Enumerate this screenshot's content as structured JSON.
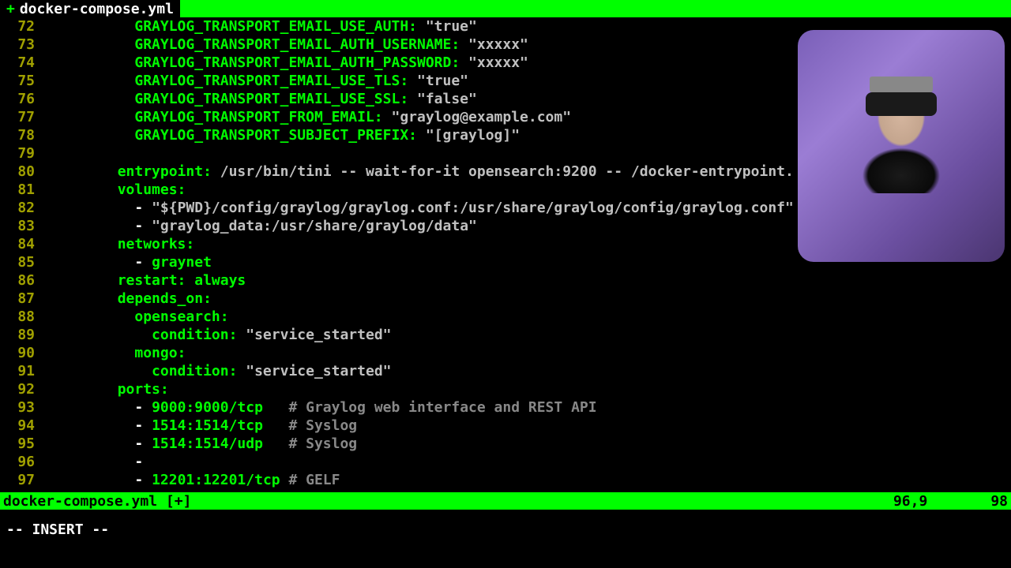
{
  "tab": {
    "marker": "+",
    "title": "docker-compose.yml"
  },
  "status": {
    "file": "docker-compose.yml [+]",
    "pos": "96,9",
    "pct": "98"
  },
  "mode": "-- INSERT --",
  "lines": [
    {
      "n": "72",
      "i": "          ",
      "k": "GRAYLOG_TRANSPORT_EMAIL_USE_AUTH:",
      "s": " \"true\""
    },
    {
      "n": "73",
      "i": "          ",
      "k": "GRAYLOG_TRANSPORT_EMAIL_AUTH_USERNAME:",
      "s": " \"xxxxx\""
    },
    {
      "n": "74",
      "i": "          ",
      "k": "GRAYLOG_TRANSPORT_EMAIL_AUTH_PASSWORD:",
      "s": " \"xxxxx\""
    },
    {
      "n": "75",
      "i": "          ",
      "k": "GRAYLOG_TRANSPORT_EMAIL_USE_TLS:",
      "s": " \"true\""
    },
    {
      "n": "76",
      "i": "          ",
      "k": "GRAYLOG_TRANSPORT_EMAIL_USE_SSL:",
      "s": " \"false\""
    },
    {
      "n": "77",
      "i": "          ",
      "k": "GRAYLOG_TRANSPORT_FROM_EMAIL:",
      "s": " \"graylog@example.com\""
    },
    {
      "n": "78",
      "i": "          ",
      "k": "GRAYLOG_TRANSPORT_SUBJECT_PREFIX:",
      "s": " \"[graylog]\""
    },
    {
      "n": "79",
      "blank": true
    },
    {
      "n": "80",
      "i": "        ",
      "k": "entrypoint:",
      "p": " /usr/bin/tini -- wait-for-it opensearch:9200 -- /docker-entrypoint."
    },
    {
      "n": "81",
      "i": "        ",
      "k": "volumes:"
    },
    {
      "n": "82",
      "i": "          ",
      "d": "- ",
      "s": "\"${PWD}/config/graylog/graylog.conf:/usr/share/graylog/config/graylog.conf\""
    },
    {
      "n": "83",
      "i": "          ",
      "d": "- ",
      "s": "\"graylog_data:/usr/share/graylog/data\""
    },
    {
      "n": "84",
      "i": "        ",
      "k": "networks:"
    },
    {
      "n": "85",
      "i": "          ",
      "d": "- ",
      "v": "graynet"
    },
    {
      "n": "86",
      "i": "        ",
      "k": "restart:",
      "v": " always"
    },
    {
      "n": "87",
      "i": "        ",
      "k": "depends_on:"
    },
    {
      "n": "88",
      "i": "          ",
      "k": "opensearch:"
    },
    {
      "n": "89",
      "i": "            ",
      "k": "condition:",
      "s": " \"service_started\""
    },
    {
      "n": "90",
      "i": "          ",
      "k": "mongo:"
    },
    {
      "n": "91",
      "i": "            ",
      "k": "condition:",
      "s": " \"service_started\""
    },
    {
      "n": "92",
      "i": "        ",
      "k": "ports:"
    },
    {
      "n": "93",
      "i": "          ",
      "d": "- ",
      "v": "9000:9000/tcp   ",
      "c": "# Graylog web interface and REST API"
    },
    {
      "n": "94",
      "i": "          ",
      "d": "- ",
      "v": "1514:1514/tcp   ",
      "c": "# Syslog"
    },
    {
      "n": "95",
      "i": "          ",
      "d": "- ",
      "v": "1514:1514/udp   ",
      "c": "# Syslog"
    },
    {
      "n": "96",
      "i": "          ",
      "d": "-"
    },
    {
      "n": "97",
      "i": "          ",
      "d": "- ",
      "v": "12201:12201/tcp ",
      "c": "# GELF"
    }
  ]
}
